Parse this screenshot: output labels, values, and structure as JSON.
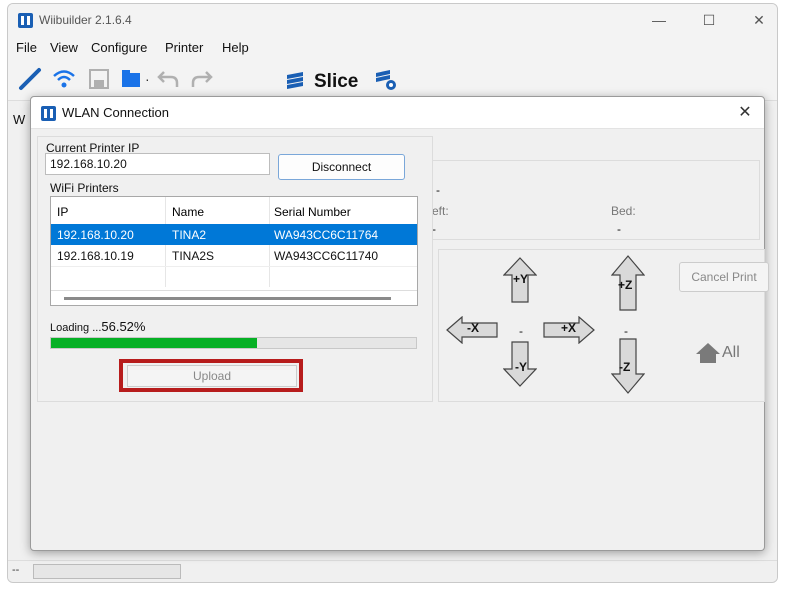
{
  "app": {
    "title": "Wiibuilder 2.1.6.4",
    "brand_color": "#1a5fb4"
  },
  "window_controls": {
    "minimize": "—",
    "maximize": "☐",
    "close": "✕"
  },
  "menu": [
    "File",
    "View",
    "Configure",
    "Printer",
    "Help"
  ],
  "toolbar": {
    "slice_label": "Slice",
    "icons": [
      "connect-cable-icon",
      "wifi-icon",
      "save-icon",
      "open-folder-icon",
      "undo-icon",
      "redo-icon",
      "slice-layers-icon",
      "slice-settings-icon"
    ]
  },
  "background": {
    "tab_prefix": "W",
    "extruder_left": "eft:",
    "bed": "Bed:",
    "dash": "-",
    "cancel_print": "Cancel Print",
    "home_all": "All",
    "jog": {
      "x_minus": "-X",
      "x_plus": "+X",
      "y_plus": "+Y",
      "y_minus": "-Y",
      "z_plus": "+Z",
      "z_minus": "-Z",
      "center": "-",
      "z_center": "-"
    }
  },
  "dialog": {
    "title": "WLAN Connection",
    "close": "✕",
    "current_ip_label": "Current Printer IP",
    "current_ip_value": "192.168.10.20",
    "disconnect_label": "Disconnect",
    "wifi_label": "WiFi Printers",
    "columns": [
      "IP",
      "Name",
      "Serial Number"
    ],
    "rows": [
      {
        "ip": "192.168.10.20",
        "name": "TINA2",
        "serial": "WA943CC6C11764",
        "selected": true
      },
      {
        "ip": "192.168.10.19",
        "name": "TINA2S",
        "serial": "WA943CC6C11740",
        "selected": false
      }
    ],
    "loading_prefix": "Loading ...",
    "loading_value": "56.52%",
    "progress": 0.5652,
    "upload_label": "Upload",
    "select_color": "#0078d7",
    "progress_color": "#06b025"
  },
  "status": {
    "text": "--"
  }
}
